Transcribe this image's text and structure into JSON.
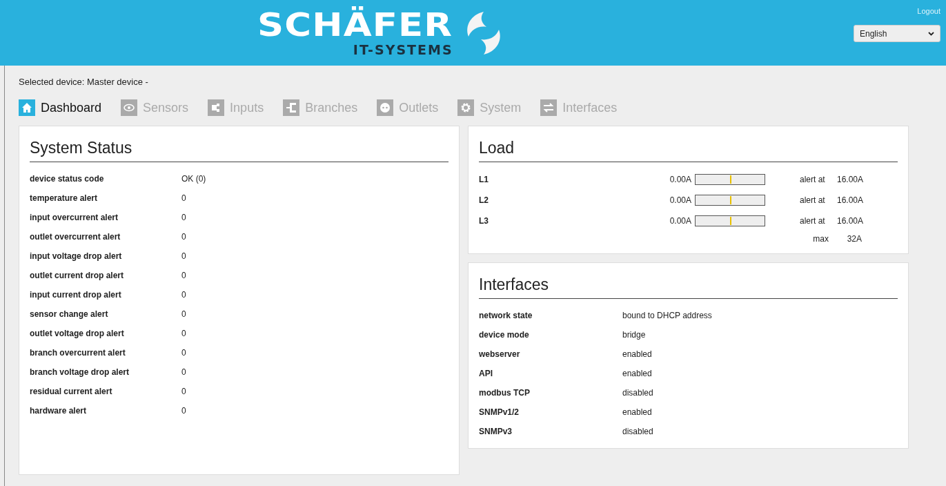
{
  "header": {
    "logo_name": "SCHÄFER",
    "logo_tagline": "IT-SYSTEMS",
    "logout": "Logout",
    "language": {
      "value": "English"
    }
  },
  "selected_device": "Selected device: Master device -",
  "tabs": [
    {
      "label": "Dashboard",
      "kind": "home",
      "selected": true
    },
    {
      "label": "Sensors",
      "kind": "eye",
      "selected": false
    },
    {
      "label": "Inputs",
      "kind": "plug",
      "selected": false
    },
    {
      "label": "Branches",
      "kind": "branch",
      "selected": false
    },
    {
      "label": "Outlets",
      "kind": "socket",
      "selected": false
    },
    {
      "label": "System",
      "kind": "gear",
      "selected": false
    },
    {
      "label": "Interfaces",
      "kind": "arrows",
      "selected": false
    }
  ],
  "system_status": {
    "title": "System Status",
    "rows": [
      {
        "label": "device status code",
        "value": "OK (0)"
      },
      {
        "label": "temperature alert",
        "value": "0"
      },
      {
        "label": "input overcurrent alert",
        "value": "0"
      },
      {
        "label": "outlet overcurrent alert",
        "value": "0"
      },
      {
        "label": "input voltage drop alert",
        "value": "0"
      },
      {
        "label": "outlet current drop alert",
        "value": "0"
      },
      {
        "label": "input current drop alert",
        "value": "0"
      },
      {
        "label": "sensor change alert",
        "value": "0"
      },
      {
        "label": "outlet voltage drop alert",
        "value": "0"
      },
      {
        "label": "branch overcurrent alert",
        "value": "0"
      },
      {
        "label": "branch voltage drop alert",
        "value": "0"
      },
      {
        "label": "residual current alert",
        "value": "0"
      },
      {
        "label": "hardware alert",
        "value": "0"
      }
    ]
  },
  "load": {
    "title": "Load",
    "phases": [
      {
        "name": "L1",
        "reading": "0.00A",
        "level": 0,
        "alert_label": "alert at",
        "alert_value": "16.00A"
      },
      {
        "name": "L2",
        "reading": "0.00A",
        "level": 0,
        "alert_label": "alert at",
        "alert_value": "16.00A"
      },
      {
        "name": "L3",
        "reading": "0.00A",
        "level": 0,
        "alert_label": "alert at",
        "alert_value": "16.00A"
      }
    ],
    "max_label": "max",
    "max_value": "32A"
  },
  "interfaces": {
    "title": "Interfaces",
    "rows": [
      {
        "label": "network state",
        "value": "bound to DHCP address"
      },
      {
        "label": "device mode",
        "value": "bridge"
      },
      {
        "label": "webserver",
        "value": "enabled"
      },
      {
        "label": "API",
        "value": "enabled"
      },
      {
        "label": "modbus TCP",
        "value": "disabled"
      },
      {
        "label": "SNMPv1/2",
        "value": "enabled"
      },
      {
        "label": "SNMPv3",
        "value": "disabled"
      }
    ]
  }
}
